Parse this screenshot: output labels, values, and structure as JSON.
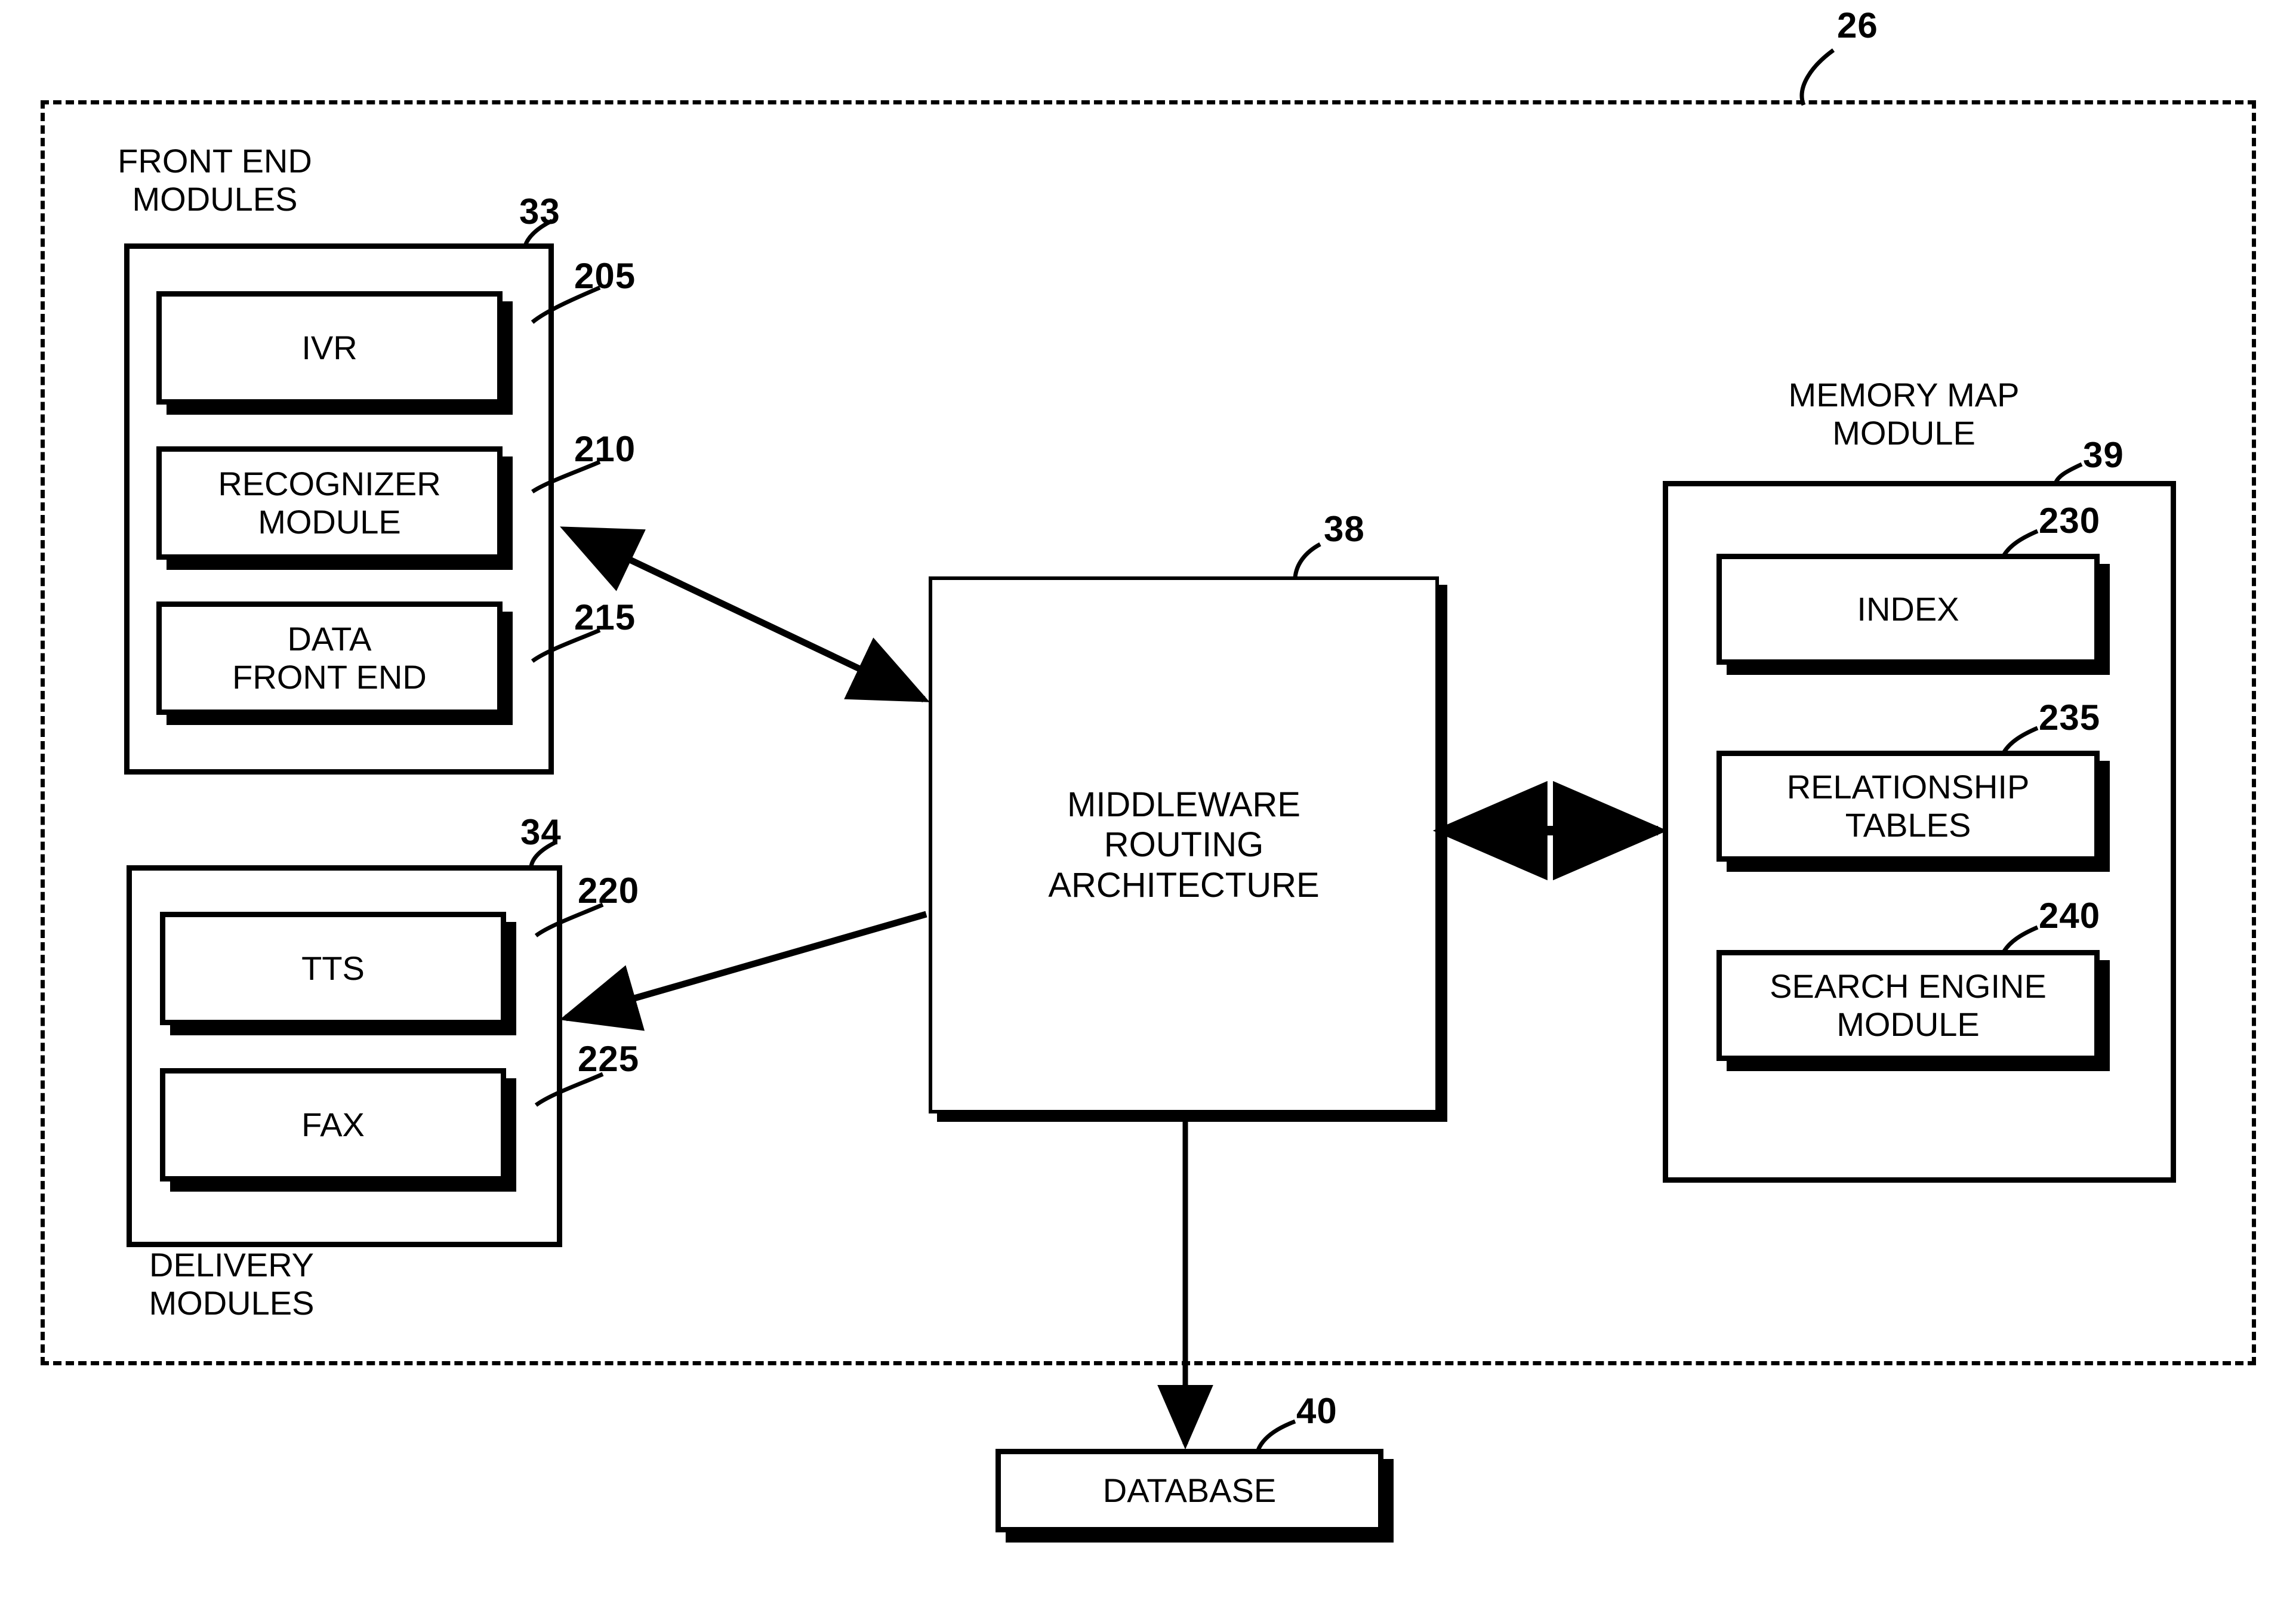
{
  "figure": {
    "type": "patent-block-diagram",
    "system_ref": "26"
  },
  "groups": {
    "front_end": {
      "title": "FRONT END\nMODULES",
      "ref": "33",
      "items": [
        {
          "label": "IVR",
          "ref": "205"
        },
        {
          "label": "RECOGNIZER\nMODULE",
          "ref": "210"
        },
        {
          "label": "DATA\nFRONT END",
          "ref": "215"
        }
      ]
    },
    "delivery": {
      "title": "DELIVERY\nMODULES",
      "ref": "34",
      "items": [
        {
          "label": "TTS",
          "ref": "220"
        },
        {
          "label": "FAX",
          "ref": "225"
        }
      ]
    },
    "memory_map": {
      "title": "MEMORY MAP\nMODULE",
      "ref": "39",
      "items": [
        {
          "label": "INDEX",
          "ref": "230"
        },
        {
          "label": "RELATIONSHIP\nTABLES",
          "ref": "235"
        },
        {
          "label": "SEARCH ENGINE\nMODULE",
          "ref": "240"
        }
      ]
    }
  },
  "middleware": {
    "label": "MIDDLEWARE\nROUTING\nARCHITECTURE",
    "ref": "38"
  },
  "database": {
    "label": "DATABASE",
    "ref": "40"
  },
  "colors": {
    "ink": "#000000",
    "paper": "#ffffff"
  }
}
